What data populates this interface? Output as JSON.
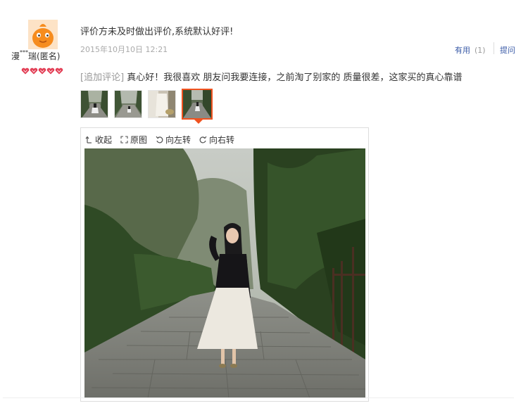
{
  "user": {
    "name_prefix": "漫",
    "name_mask": "***",
    "name_suffix": "瑞",
    "anonymous": "(匿名)"
  },
  "review": {
    "text": "评价方未及时做出评价,系统默认好评!",
    "date": "2015年10月10日 12:21",
    "useful_label": "有用",
    "useful_count": "(1)",
    "ask_label": "提问"
  },
  "append": {
    "tag": "[追加评论]",
    "text": "真心好！我很喜欢 朋友问我要连接，之前淘了别家的 质量很差，这家买的真心靠谱"
  },
  "viewer": {
    "collapse_label": "收起",
    "original_label": "原图",
    "rotate_left_label": "向左转",
    "rotate_right_label": "向右转",
    "thumbnail_count": 4,
    "selected_thumbnail": 4
  },
  "colors": {
    "accent": "#f0521f",
    "link": "#3c5ca8",
    "muted": "#aaaaaa"
  }
}
